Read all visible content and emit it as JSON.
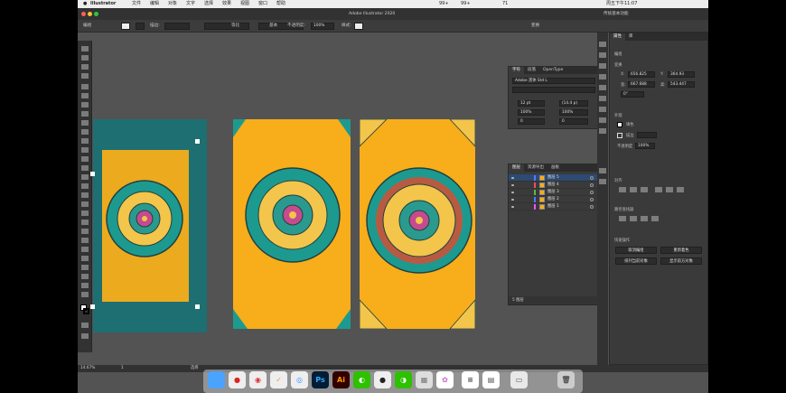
{
  "menubar": {
    "app": "Illustrator",
    "menus": [
      "文件",
      "编辑",
      "对象",
      "文字",
      "选择",
      "效果",
      "视图",
      "窗口",
      "帮助"
    ],
    "title": "Adobe Illustrator 2020",
    "status": [
      "99+",
      "99+",
      "71"
    ],
    "clock": "周五下午11:07"
  },
  "appbar": {
    "title": "Adobe Illustrator 2020",
    "workspace": "传统基本功能"
  },
  "controlbar": {
    "group_label": "编组",
    "stroke_label": "描边:",
    "stroke_style": "等比",
    "brush_style": "基本",
    "opacity_label": "不透明度:",
    "opacity_value": "100%",
    "style_label": "样式:",
    "arrange": "变换"
  },
  "character_panel": {
    "tabs": [
      "字符",
      "段落",
      "OpenType"
    ],
    "font": "Adobe 黑体 Std L",
    "size": "12 pt",
    "leading": "(14.4 p)",
    "h_scale": "100%",
    "v_scale": "100%",
    "tracking": "0",
    "kerning": "0"
  },
  "layers_panel": {
    "tabs": [
      "图层",
      "资源导出",
      "画板"
    ],
    "layers": [
      {
        "name": "图层 5",
        "color": "#4f7bff",
        "selected": true
      },
      {
        "name": "图层 4",
        "color": "#ff4f4f",
        "selected": false
      },
      {
        "name": "图层 3",
        "color": "#4fbf4f",
        "selected": false
      },
      {
        "name": "图层 2",
        "color": "#4f7bff",
        "selected": false
      },
      {
        "name": "图层 1",
        "color": "#ff4fff",
        "selected": false
      }
    ],
    "count": "5 图层"
  },
  "properties_panel": {
    "tabs": [
      "属性",
      "库"
    ],
    "section_group": "编组",
    "section_transform": "变换",
    "x_label": "X:",
    "x_value": "656.825",
    "y_label": "Y:",
    "y_value": "364.93",
    "w_label": "宽:",
    "w_value": "667.688",
    "h_label": "高:",
    "h_value": "543.447",
    "angle": "0°",
    "section_appearance": "外观",
    "fill_label": "填色",
    "stroke_label": "描边",
    "opacity_label": "不透明度",
    "opacity_value": "100%",
    "section_align": "对齐",
    "section_pathfinder": "路径查找器",
    "section_quick": "快速操作",
    "quick_buttons": [
      "取消编组",
      "重新着色",
      "排列当前对象",
      "显示前方对象"
    ]
  },
  "status": {
    "zoom": "14.67%",
    "page": "1",
    "tool": "选择"
  },
  "dock": {
    "icons": [
      "finder",
      "qq",
      "chrome",
      "reminder",
      "safari",
      "photoshop",
      "illustrator",
      "wechat",
      "qq2",
      "wechat2",
      "preview",
      "photos",
      "textedit",
      "notes",
      "folder",
      "trash"
    ]
  }
}
